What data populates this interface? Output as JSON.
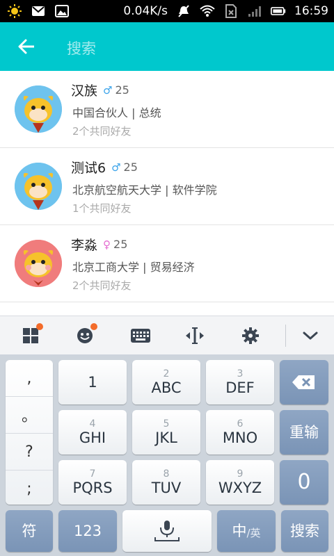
{
  "status_bar": {
    "network_speed": "0.04K/s",
    "time": "16:59",
    "icons": [
      "weather-sun-icon",
      "mail-icon",
      "image-icon",
      "mute-icon",
      "wifi-icon",
      "sim-icon",
      "signal-icon",
      "battery-icon"
    ]
  },
  "app_bar": {
    "back_icon": "arrow-left-icon",
    "search_placeholder": "搜索",
    "accent_color": "#00c8cd"
  },
  "results": [
    {
      "name": "汉族",
      "gender_symbol": "♂",
      "gender": "male",
      "age": "25",
      "info": "中国合伙人 | 总统",
      "mutual_friends": "2个共同好友",
      "avatar_color": "#6ec3ee"
    },
    {
      "name": "测试6",
      "gender_symbol": "♂",
      "gender": "male",
      "age": "25",
      "info": "北京航空航天大学 | 软件学院",
      "mutual_friends": "1个共同好友",
      "avatar_color": "#6ec3ee"
    },
    {
      "name": "李淼",
      "gender_symbol": "♀",
      "gender": "female",
      "age": "25",
      "info": "北京工商大学 | 贸易经济",
      "mutual_friends": "2个共同好友",
      "avatar_color": "#f07c7c"
    }
  ],
  "keyboard": {
    "toolbar_icons": [
      "apps-grid-icon",
      "emoji-icon",
      "keyboard-icon",
      "cursor-move-icon",
      "settings-gear-icon",
      "chevron-down-icon"
    ],
    "punctuation": [
      ",",
      "。",
      "?",
      ";"
    ],
    "keys": {
      "k1": {
        "main": "1",
        "sub": ""
      },
      "k2": {
        "main": "ABC",
        "sub": "2"
      },
      "k3": {
        "main": "DEF",
        "sub": "3"
      },
      "k4": {
        "main": "GHI",
        "sub": "4"
      },
      "k5": {
        "main": "JKL",
        "sub": "5"
      },
      "k6": {
        "main": "MNO",
        "sub": "6"
      },
      "k7": {
        "main": "PQRS",
        "sub": "7"
      },
      "k8": {
        "main": "TUV",
        "sub": "8"
      },
      "k9": {
        "main": "WXYZ",
        "sub": "9"
      },
      "k0": {
        "main": "0"
      }
    },
    "reenter_label": "重输",
    "symbols_label": "符",
    "numeric_label": "123",
    "lang_main": "中",
    "lang_sub": "/英",
    "search_label": "搜索",
    "toolbar_color": "#f3f4f6",
    "key_dark_color": "#7a94b6"
  }
}
